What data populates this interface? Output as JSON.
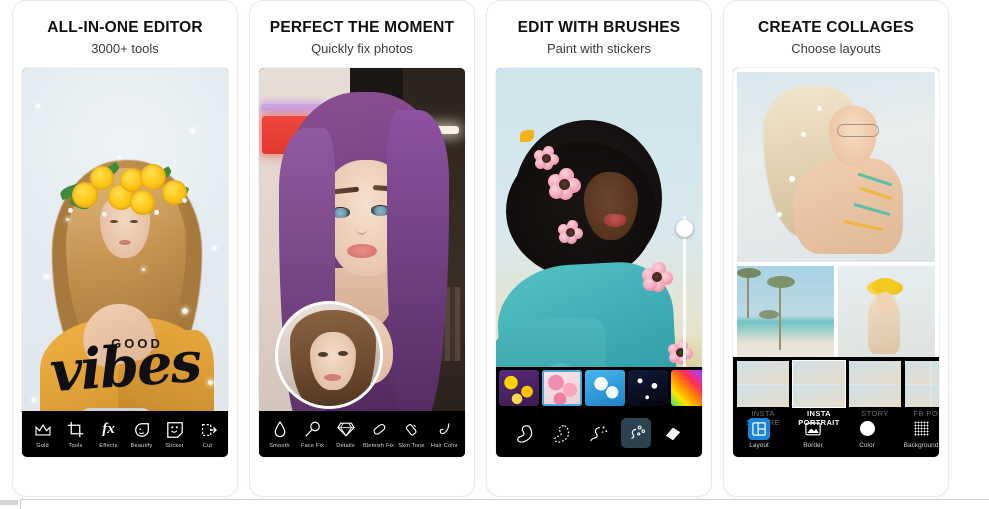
{
  "app": {
    "carousel_name": "photo-editor-app-screenshots"
  },
  "cards": [
    {
      "title": "ALL-IN-ONE EDITOR",
      "subtitle": "3000+ tools",
      "overlay_text_small": "GOOD",
      "overlay_text_script": "vibes",
      "toolbar": [
        {
          "label": "Gold",
          "icon": "crown-icon"
        },
        {
          "label": "Tools",
          "icon": "crop-icon"
        },
        {
          "label": "Effects",
          "icon": "fx-icon"
        },
        {
          "label": "Beautify",
          "icon": "face-beautify-icon"
        },
        {
          "label": "Sticker",
          "icon": "sticker-icon"
        },
        {
          "label": "Cut",
          "icon": "cutout-icon"
        }
      ]
    },
    {
      "title": "PERFECT THE MOMENT",
      "subtitle": "Quickly fix photos",
      "toolbar": [
        {
          "label": "Smooth",
          "icon": "droplet-icon"
        },
        {
          "label": "Face Fix",
          "icon": "magnifier-icon"
        },
        {
          "label": "Details",
          "icon": "diamond-icon"
        },
        {
          "label": "Blemish Fix",
          "icon": "patch-icon"
        },
        {
          "label": "Skin Tone",
          "icon": "lipstick-icon"
        },
        {
          "label": "Hair Color",
          "icon": "hair-curl-icon"
        }
      ]
    },
    {
      "title": "EDIT WITH BRUSHES",
      "subtitle": "Paint with stickers",
      "brush_swatches": [
        {
          "name": "lemons-brush",
          "selected": false,
          "color": "#6d2f8a"
        },
        {
          "name": "pink-flowers-brush",
          "selected": true,
          "color": "#f3b7c4"
        },
        {
          "name": "white-blossom-brush",
          "selected": false,
          "color": "#2f9ddd"
        },
        {
          "name": "sparkle-brush",
          "selected": false,
          "color": "#0c1430"
        },
        {
          "name": "rainbow-brush",
          "selected": false,
          "color": "#ff3b3b"
        },
        {
          "name": "glitter-brush",
          "selected": false,
          "color": "#101018"
        }
      ],
      "tools": [
        {
          "name": "brush-stamp-tool",
          "selected": false
        },
        {
          "name": "brush-dotted-tool",
          "selected": false
        },
        {
          "name": "brush-sparkle-tool",
          "selected": false
        },
        {
          "name": "brush-scatter-tool",
          "selected": true
        },
        {
          "name": "eraser-tool",
          "selected": false
        }
      ]
    },
    {
      "title": "CREATE COLLAGES",
      "subtitle": "Choose layouts",
      "layouts": [
        {
          "label": "INSTA SQUARE",
          "selected": false
        },
        {
          "label": "INSTA PORTRAIT",
          "selected": true
        },
        {
          "label": "STORY",
          "selected": false
        },
        {
          "label": "FB POST",
          "selected": false
        }
      ],
      "tools": [
        {
          "label": "Layout",
          "icon": "layout-grid-icon",
          "selected": true
        },
        {
          "label": "Border",
          "icon": "border-image-icon",
          "selected": false
        },
        {
          "label": "Color",
          "icon": "color-circle-icon",
          "selected": false
        },
        {
          "label": "Background",
          "icon": "pattern-icon",
          "selected": false
        }
      ]
    }
  ],
  "colors": {
    "accent_blue": "#1a84d8",
    "toolbar_black": "#000000",
    "card_border": "#e9e9e9",
    "title_text": "#111114",
    "subtitle_text": "#3b3b40"
  }
}
